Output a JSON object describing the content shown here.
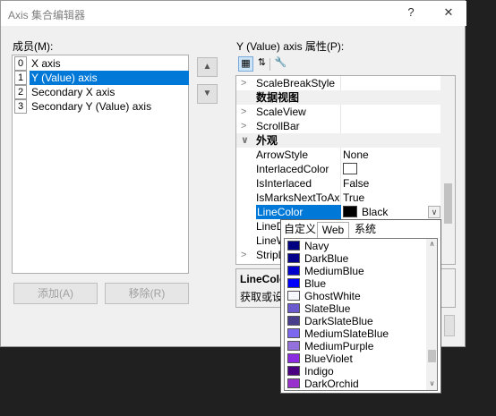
{
  "window": {
    "title": "Axis 集合编辑器",
    "help": "?",
    "close": "✕"
  },
  "members": {
    "label": "成员(M):",
    "items": [
      {
        "index": "0",
        "name": "X axis",
        "selected": false
      },
      {
        "index": "1",
        "name": "Y (Value) axis",
        "selected": true
      },
      {
        "index": "2",
        "name": "Secondary X axis",
        "selected": false
      },
      {
        "index": "3",
        "name": "Secondary Y (Value) axis",
        "selected": false
      }
    ],
    "add_label": "添加(A)",
    "remove_label": "移除(R)"
  },
  "properties": {
    "label": "Y (Value) axis 属性(P):",
    "rows": [
      {
        "kind": "prop",
        "expand": ">",
        "name": "ScaleBreakStyle",
        "value": ""
      },
      {
        "kind": "cat",
        "expand": "",
        "name": "数据视图",
        "value": ""
      },
      {
        "kind": "prop",
        "expand": ">",
        "name": "ScaleView",
        "value": ""
      },
      {
        "kind": "prop",
        "expand": ">",
        "name": "ScrollBar",
        "value": ""
      },
      {
        "kind": "cat",
        "expand": "∨",
        "name": "外观",
        "value": ""
      },
      {
        "kind": "prop",
        "expand": "",
        "name": "ArrowStyle",
        "value": "None"
      },
      {
        "kind": "prop",
        "expand": "",
        "name": "InterlacedColor",
        "value": "",
        "swatch": "#ffffff"
      },
      {
        "kind": "prop",
        "expand": "",
        "name": "IsInterlaced",
        "value": "False"
      },
      {
        "kind": "prop",
        "expand": "",
        "name": "IsMarksNextToAxis",
        "value": "True"
      },
      {
        "kind": "sel",
        "expand": "",
        "name": "LineColor",
        "value": "Black",
        "swatch": "#000000"
      },
      {
        "kind": "prop",
        "expand": "",
        "name": "LineDashStyle",
        "value": ""
      },
      {
        "kind": "prop",
        "expand": "",
        "name": "LineWidth",
        "value": ""
      },
      {
        "kind": "prop",
        "expand": ">",
        "name": "StripLines",
        "value": ""
      }
    ],
    "description_title": "LineColor",
    "description_text": "获取或设置轴线的颜色。"
  },
  "color_popup": {
    "tabs": [
      "自定义",
      "Web",
      "系统"
    ],
    "active_tab": 1,
    "colors": [
      {
        "name": "Navy",
        "hex": "#000080"
      },
      {
        "name": "DarkBlue",
        "hex": "#00008b"
      },
      {
        "name": "MediumBlue",
        "hex": "#0000cd"
      },
      {
        "name": "Blue",
        "hex": "#0000ff"
      },
      {
        "name": "GhostWhite",
        "hex": "#f8f8ff"
      },
      {
        "name": "SlateBlue",
        "hex": "#6a5acd"
      },
      {
        "name": "DarkSlateBlue",
        "hex": "#483d8b"
      },
      {
        "name": "MediumSlateBlue",
        "hex": "#7b68ee"
      },
      {
        "name": "MediumPurple",
        "hex": "#9370db"
      },
      {
        "name": "BlueViolet",
        "hex": "#8a2be2"
      },
      {
        "name": "Indigo",
        "hex": "#4b0082"
      },
      {
        "name": "DarkOrchid",
        "hex": "#9932cc"
      }
    ]
  },
  "colors": {
    "accent": "#0078d7"
  }
}
